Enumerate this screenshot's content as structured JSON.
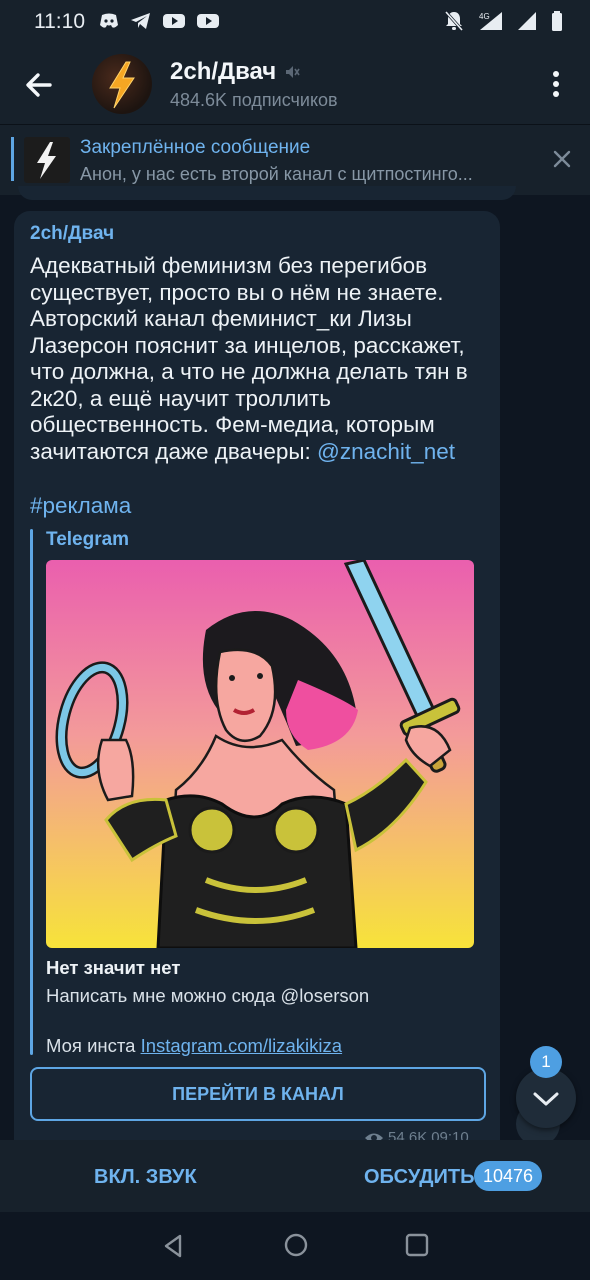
{
  "status_bar": {
    "time": "11:10",
    "network_label": "4G"
  },
  "header": {
    "channel_name": "2ch/Двач",
    "subscribers": "484.6K подписчиков"
  },
  "pinned": {
    "title": "Закреплённое сообщение",
    "text": "Анон, у нас есть второй канал с щитпостинго..."
  },
  "message": {
    "author": "2ch/Двач",
    "text": "Адекватный феминизм без перегибов существует, просто вы о нём не знаете. Авторский канал феминист_ки Лизы Лазерсон пояснит за инцелов, расскажет, что должна, а что не должна делать тян в 2к20, а ещё научит троллить общественность. Фем-медиа, которым зачитаются даже двачеры: ",
    "mention": "@znachit_net",
    "hashtag": "#реклама",
    "preview": {
      "site": "Telegram",
      "title": "Нет значит нет",
      "description": "Написать мне можно сюда @loserson",
      "insta_prefix": "Моя инста ",
      "insta_link": "Instagram.com/lizakikiza"
    },
    "open_channel_button": "ПЕРЕЙТИ В КАНАЛ",
    "views": "54.6K",
    "time": "09:10"
  },
  "fab": {
    "unread_count": "1"
  },
  "bottom_bar": {
    "sound_button": "ВКЛ. ЗВУК",
    "discuss_button": "ОБСУДИТЬ",
    "comments_count": "10476"
  },
  "colors": {
    "background": "#0e1621",
    "bar": "#17212b",
    "bubble": "#182533",
    "accent": "#6fb3ee"
  }
}
